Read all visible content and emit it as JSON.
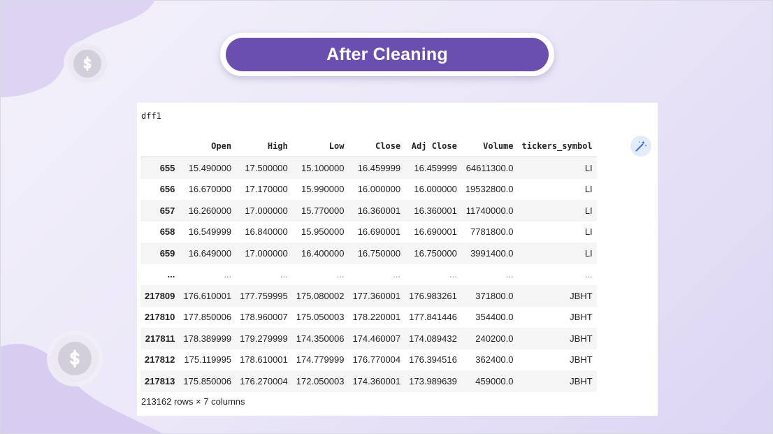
{
  "slide": {
    "title": "After Cleaning",
    "coin_icon": "dollar-coin-icon",
    "colors": {
      "accent": "#6a4eb0",
      "background": "#ece8f8",
      "blob": "#d9d1f1"
    }
  },
  "notebook": {
    "variable": "dff1",
    "wand_icon": "magic-wand-icon",
    "columns": [
      "",
      "Open",
      "High",
      "Low",
      "Close",
      "Adj Close",
      "Volume",
      "tickers_symbol"
    ],
    "rows": [
      [
        "655",
        "15.490000",
        "17.500000",
        "15.100000",
        "16.459999",
        "16.459999",
        "64611300.0",
        "LI"
      ],
      [
        "656",
        "16.670000",
        "17.170000",
        "15.990000",
        "16.000000",
        "16.000000",
        "19532800.0",
        "LI"
      ],
      [
        "657",
        "16.260000",
        "17.000000",
        "15.770000",
        "16.360001",
        "16.360001",
        "11740000.0",
        "LI"
      ],
      [
        "658",
        "16.549999",
        "16.840000",
        "15.950000",
        "16.690001",
        "16.690001",
        "7781800.0",
        "LI"
      ],
      [
        "659",
        "16.649000",
        "17.000000",
        "16.400000",
        "16.750000",
        "16.750000",
        "3991400.0",
        "LI"
      ],
      [
        "...",
        "...",
        "...",
        "...",
        "...",
        "...",
        "...",
        "..."
      ],
      [
        "217809",
        "176.610001",
        "177.759995",
        "175.080002",
        "177.360001",
        "176.983261",
        "371800.0",
        "JBHT"
      ],
      [
        "217810",
        "177.850006",
        "178.960007",
        "175.050003",
        "178.220001",
        "177.841446",
        "354400.0",
        "JBHT"
      ],
      [
        "217811",
        "178.389999",
        "179.279999",
        "174.350006",
        "174.460007",
        "174.089432",
        "240200.0",
        "JBHT"
      ],
      [
        "217812",
        "175.119995",
        "178.610001",
        "174.779999",
        "176.770004",
        "176.394516",
        "362400.0",
        "JBHT"
      ],
      [
        "217813",
        "175.850006",
        "176.270004",
        "172.050003",
        "174.360001",
        "173.989639",
        "459000.0",
        "JBHT"
      ]
    ],
    "shape": "213162 rows × 7 columns"
  }
}
